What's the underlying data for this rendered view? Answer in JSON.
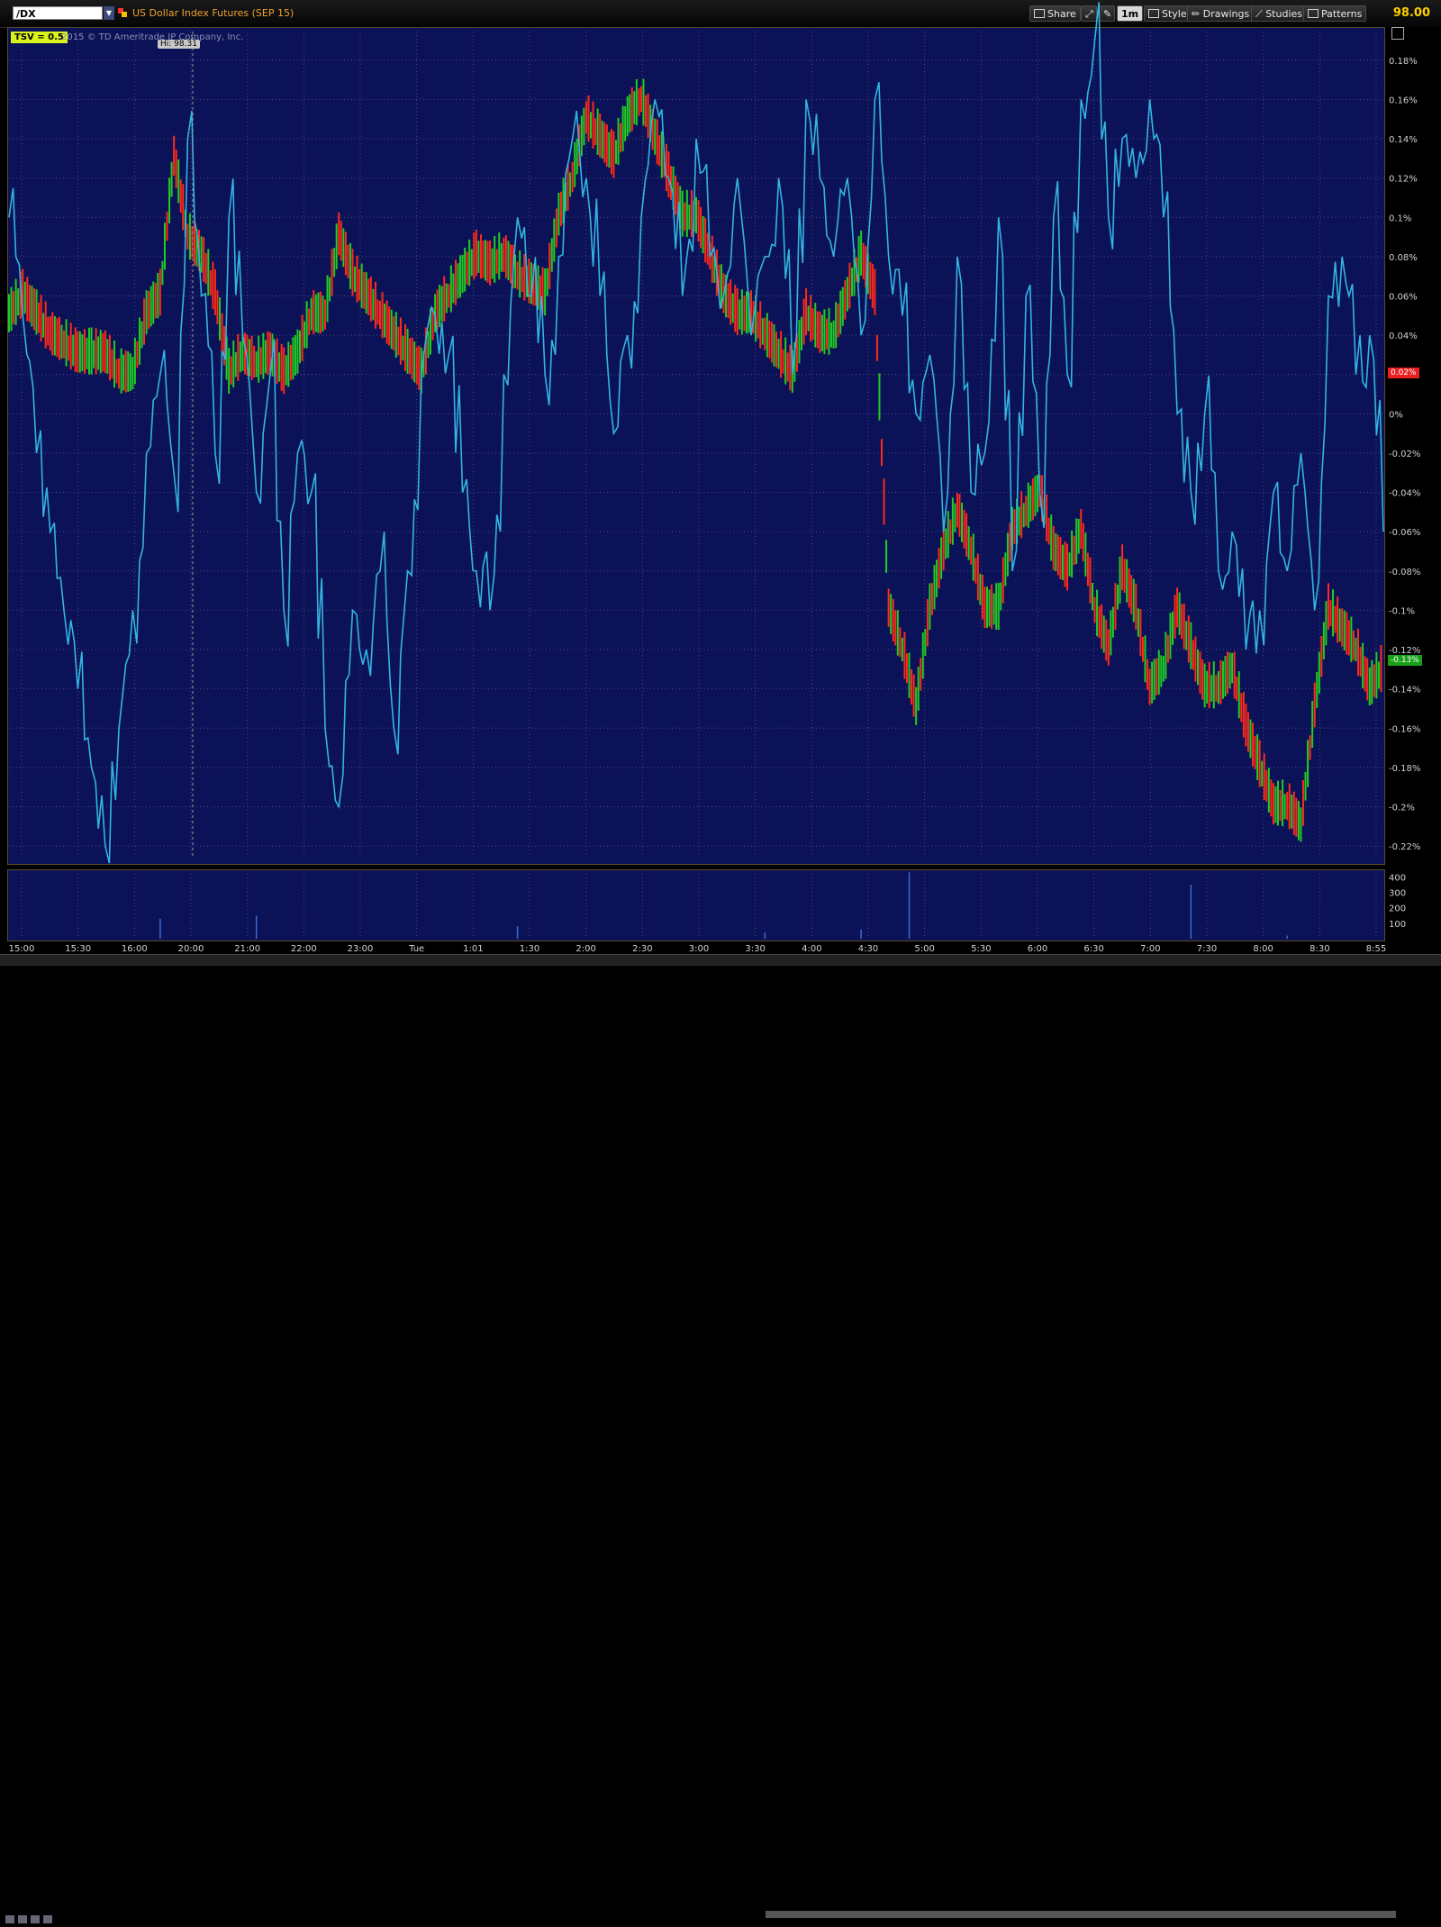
{
  "toolbar": {
    "symbol": "/DX",
    "instrument_title": "US Dollar Index Futures (SEP 15)",
    "share_label": "Share",
    "aggregation_label": "1m",
    "style_label": "Style",
    "drawings_label": "Drawings",
    "studies_label": "Studies",
    "patterns_label": "Patterns",
    "last_price": "98.00"
  },
  "chart": {
    "study_label": "TSV = 0.5",
    "copyright": "2015 © TD Ameritrade IP Company, Inc.",
    "hi_label": "Hi: 98.31",
    "last_tag_red": "0.02%",
    "last_tag_green": "-0.13%"
  },
  "colors": {
    "background": "#0b1257",
    "tsv_line": "#33b5e0",
    "up_bar": "#22cc22",
    "down_bar": "#ff2a1a",
    "grid": "#4a4a80"
  },
  "chart_data": {
    "type": "line",
    "y_ticks": [
      "0.18%",
      "0.16%",
      "0.14%",
      "0.12%",
      "0.1%",
      "0.08%",
      "0.06%",
      "0.04%",
      "0.02%",
      "0%",
      "-0.02%",
      "-0.04%",
      "-0.06%",
      "-0.08%",
      "-0.1%",
      "-0.12%",
      "-0.14%",
      "-0.16%",
      "-0.18%",
      "-0.2%",
      "-0.22%"
    ],
    "ylim": [
      -0.225,
      0.19
    ],
    "x_ticks": [
      "15:00",
      "15:30",
      "16:00",
      "20:00",
      "21:00",
      "22:00",
      "23:00",
      "Tue",
      "1:01",
      "1:30",
      "2:00",
      "2:30",
      "3:00",
      "3:30",
      "4:00",
      "4:30",
      "5:00",
      "5:30",
      "6:00",
      "6:30",
      "7:00",
      "7:30",
      "8:00",
      "8:30",
      "8:55"
    ],
    "volume_ticks": [
      "400",
      "300",
      "200",
      "100"
    ],
    "volume_ylim": [
      0,
      420
    ],
    "price_series": {
      "x": [
        0,
        0.01,
        0.02,
        0.03,
        0.04,
        0.05,
        0.06,
        0.07,
        0.08,
        0.09,
        0.1,
        0.11,
        0.12,
        0.13,
        0.14,
        0.15,
        0.16,
        0.17,
        0.18,
        0.19,
        0.2,
        0.21,
        0.22,
        0.23,
        0.24,
        0.25,
        0.26,
        0.27,
        0.28,
        0.29,
        0.3,
        0.31,
        0.32,
        0.33,
        0.34,
        0.35,
        0.36,
        0.37,
        0.38,
        0.39,
        0.4,
        0.41,
        0.42,
        0.43,
        0.44,
        0.45,
        0.46,
        0.47,
        0.48,
        0.49,
        0.5,
        0.51,
        0.52,
        0.53,
        0.54,
        0.55,
        0.56,
        0.57,
        0.58,
        0.59,
        0.6,
        0.61,
        0.62,
        0.63,
        0.64,
        0.65,
        0.66,
        0.67,
        0.68,
        0.69,
        0.7,
        0.71,
        0.72,
        0.73,
        0.74,
        0.75,
        0.76,
        0.77,
        0.78,
        0.79,
        0.8,
        0.81,
        0.82,
        0.83,
        0.84,
        0.85,
        0.86,
        0.87,
        0.88,
        0.89,
        0.9,
        0.91,
        0.92,
        0.93,
        0.94,
        0.95,
        0.96,
        0.97,
        0.98,
        0.99,
        1.0
      ],
      "values": [
        0.05,
        0.06,
        0.05,
        0.04,
        0.035,
        0.03,
        0.03,
        0.03,
        0.02,
        0.02,
        0.05,
        0.06,
        0.13,
        0.09,
        0.08,
        0.06,
        0.02,
        0.03,
        0.025,
        0.03,
        0.02,
        0.03,
        0.05,
        0.05,
        0.09,
        0.07,
        0.06,
        0.05,
        0.04,
        0.03,
        0.02,
        0.05,
        0.06,
        0.07,
        0.08,
        0.075,
        0.08,
        0.07,
        0.065,
        0.06,
        0.1,
        0.12,
        0.15,
        0.14,
        0.13,
        0.15,
        0.16,
        0.14,
        0.12,
        0.1,
        0.1,
        0.08,
        0.06,
        0.05,
        0.05,
        0.04,
        0.03,
        0.02,
        0.05,
        0.04,
        0.04,
        0.06,
        0.08,
        0.06,
        -0.1,
        -0.12,
        -0.15,
        -0.1,
        -0.07,
        -0.05,
        -0.07,
        -0.1,
        -0.1,
        -0.06,
        -0.05,
        -0.04,
        -0.07,
        -0.08,
        -0.06,
        -0.1,
        -0.12,
        -0.08,
        -0.1,
        -0.14,
        -0.13,
        -0.1,
        -0.12,
        -0.14,
        -0.14,
        -0.13,
        -0.16,
        -0.18,
        -0.2,
        -0.2,
        -0.21,
        -0.15,
        -0.1,
        -0.11,
        -0.12,
        -0.14,
        -0.13
      ]
    },
    "tsv_series": {
      "x": [
        0,
        0.01,
        0.02,
        0.03,
        0.04,
        0.05,
        0.06,
        0.07,
        0.08,
        0.09,
        0.1,
        0.11,
        0.12,
        0.13,
        0.14,
        0.15,
        0.16,
        0.17,
        0.18,
        0.19,
        0.2,
        0.21,
        0.22,
        0.23,
        0.24,
        0.25,
        0.26,
        0.27,
        0.28,
        0.29,
        0.3,
        0.31,
        0.32,
        0.33,
        0.34,
        0.35,
        0.36,
        0.37,
        0.38,
        0.39,
        0.4,
        0.41,
        0.42,
        0.43,
        0.44,
        0.45,
        0.46,
        0.47,
        0.48,
        0.49,
        0.5,
        0.51,
        0.52,
        0.53,
        0.54,
        0.55,
        0.56,
        0.57,
        0.58,
        0.59,
        0.6,
        0.61,
        0.62,
        0.63,
        0.64,
        0.65,
        0.66,
        0.67,
        0.68,
        0.69,
        0.7,
        0.71,
        0.72,
        0.73,
        0.74,
        0.75,
        0.76,
        0.77,
        0.78,
        0.79,
        0.8,
        0.81,
        0.82,
        0.83,
        0.84,
        0.85,
        0.86,
        0.87,
        0.88,
        0.89,
        0.9,
        0.91,
        0.92,
        0.93,
        0.94,
        0.95,
        0.96,
        0.97,
        0.98,
        0.99,
        1.0
      ],
      "values": [
        0.1,
        0.05,
        -0.02,
        -0.06,
        -0.1,
        -0.14,
        -0.18,
        -0.22,
        -0.16,
        -0.1,
        -0.02,
        0.02,
        -0.03,
        0.14,
        0.06,
        -0.02,
        0.1,
        0.04,
        -0.04,
        0.02,
        -0.1,
        -0.02,
        -0.04,
        -0.16,
        -0.2,
        -0.1,
        -0.12,
        -0.08,
        -0.16,
        -0.08,
        0.02,
        0.05,
        0.03,
        -0.04,
        -0.08,
        -0.1,
        0.02,
        0.1,
        0.06,
        0.02,
        0.08,
        0.14,
        0.12,
        0.06,
        -0.01,
        0.04,
        0.1,
        0.16,
        0.12,
        0.06,
        0.14,
        0.08,
        0.06,
        0.12,
        0.04,
        0.08,
        0.12,
        0.02,
        0.16,
        0.12,
        0.08,
        0.12,
        0.04,
        0.16,
        0.08,
        0.05,
        0.0,
        0.03,
        -0.06,
        0.08,
        -0.04,
        -0.02,
        0.1,
        -0.08,
        0.06,
        -0.04,
        0.1,
        0.02,
        0.16,
        0.19,
        0.1,
        0.14,
        0.12,
        0.16,
        0.1,
        0.0,
        -0.04,
        0.0,
        -0.08,
        -0.06,
        -0.12,
        -0.1,
        -0.04,
        -0.08,
        -0.02,
        -0.1,
        0.06,
        0.08,
        0.02,
        0.04,
        -0.06
      ]
    },
    "volume_series": {
      "x": [
        0.11,
        0.18,
        0.37,
        0.55,
        0.62,
        0.655,
        0.86,
        0.93
      ],
      "values": [
        130,
        150,
        80,
        40,
        60,
        430,
        350,
        20
      ]
    }
  }
}
